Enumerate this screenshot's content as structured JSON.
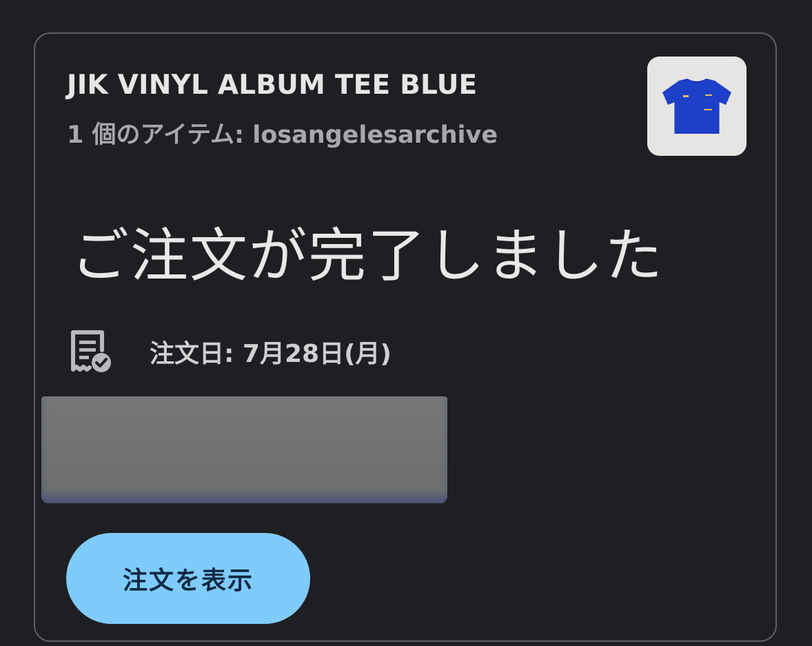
{
  "order": {
    "product_title": "JIK VINYL ALBUM TEE BLUE",
    "item_summary": "1 個のアイテム: losangelesarchive",
    "status_headline": "ご注文が完了しました",
    "order_date": "注文日: 7月28日(月)"
  },
  "actions": {
    "view_order_label": "注文を表示"
  },
  "icons": {
    "receipt": "receipt-check-icon"
  },
  "colors": {
    "background": "#1e1f22",
    "button": "#7fcbfc",
    "button_text": "#0e2a44",
    "tee": "#1e3fc8"
  }
}
